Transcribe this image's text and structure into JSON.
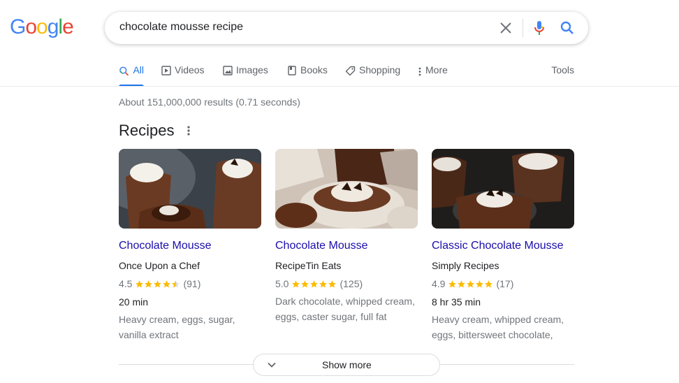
{
  "logo": {
    "letters": [
      "G",
      "o",
      "o",
      "g",
      "l",
      "e"
    ],
    "colors": [
      "#4285F4",
      "#EA4335",
      "#FBBC05",
      "#4285F4",
      "#34A853",
      "#EA4335"
    ]
  },
  "search": {
    "query": "chocolate mousse recipe"
  },
  "icons": {
    "clear": "close-icon",
    "mic": "mic-icon",
    "search": "search-icon"
  },
  "tabs": [
    {
      "label": "All",
      "icon": "search-icon",
      "active": true
    },
    {
      "label": "Videos",
      "icon": "video-icon"
    },
    {
      "label": "Images",
      "icon": "image-icon"
    },
    {
      "label": "Books",
      "icon": "book-icon"
    },
    {
      "label": "Shopping",
      "icon": "tag-icon"
    },
    {
      "label": "More",
      "icon": "more-vert-icon"
    }
  ],
  "tools_label": "Tools",
  "result_stats": "About 151,000,000 results (0.71 seconds)",
  "recipes": {
    "title": "Recipes",
    "cards": [
      {
        "title": "Chocolate Mousse",
        "source": "Once Upon a Chef",
        "rating": "4.5",
        "stars": 4.5,
        "reviews": "(91)",
        "time": "20 min",
        "ingredients": [
          "Heavy cream, eggs, sugar,",
          "vanilla extract"
        ]
      },
      {
        "title": "Chocolate Mousse",
        "source": "RecipeTin Eats",
        "rating": "5.0",
        "stars": 5,
        "reviews": "(125)",
        "time": "",
        "ingredients": [
          "Dark chocolate, whipped cream,",
          "eggs, caster sugar, full fat"
        ]
      },
      {
        "title": "Classic Chocolate Mousse",
        "source": "Simply Recipes",
        "rating": "4.9",
        "stars": 5,
        "reviews": "(17)",
        "time": "8 hr 35 min",
        "ingredients": [
          "Heavy cream, whipped cream,",
          "eggs, bittersweet chocolate,"
        ]
      }
    ]
  },
  "show_more_label": "Show more",
  "colors": {
    "accent": "#1a73e8",
    "link": "#1a0dab",
    "star": "#fbbc04"
  }
}
